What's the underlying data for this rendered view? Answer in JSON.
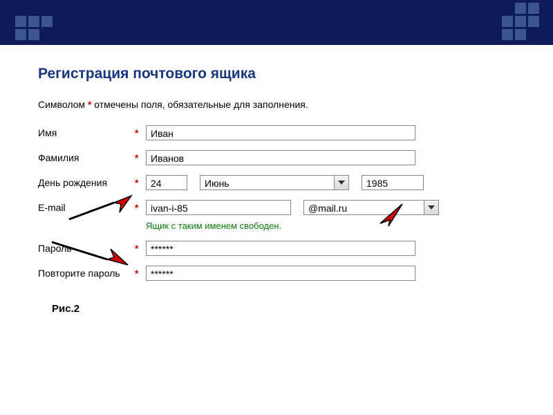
{
  "header": {
    "title": "Регистрация почтового ящика"
  },
  "note": {
    "pre": "Символом ",
    "mark": "*",
    "post": " отмечены поля, обязательные для заполнения."
  },
  "fields": {
    "first_name": {
      "label": "Имя",
      "value": "Иван"
    },
    "last_name": {
      "label": "Фамилия",
      "value": "Иванов"
    },
    "birthday": {
      "label": "День рождения",
      "day": "24",
      "month": "Июнь",
      "year": "1985"
    },
    "email": {
      "label": "E-mail",
      "user": "ivan-i-85",
      "domain": "@mail.ru",
      "available_msg": "Ящик с таким именем свободен."
    },
    "password": {
      "label": "Пароль",
      "value": "******"
    },
    "password_repeat": {
      "label": "Повторите пароль",
      "value": "******"
    }
  },
  "required_mark": "*",
  "caption": "Рис.2"
}
